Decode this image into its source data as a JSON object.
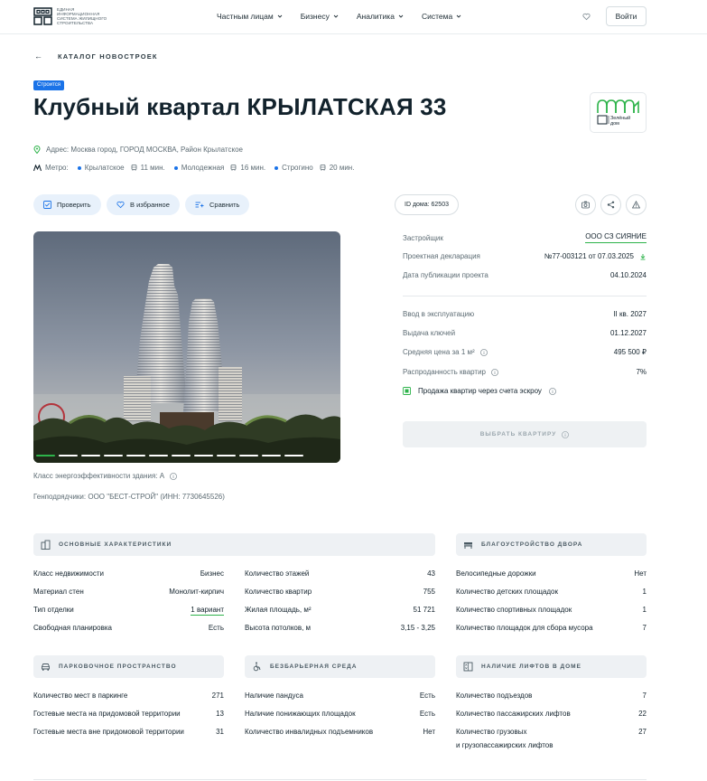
{
  "header": {
    "logo_text": "ЕДИНАЯ ИНФОРМАЦИОННАЯ СИСТЕМА ЖИЛИЩНОГО СТРОИТЕЛЬСТВА",
    "nav": [
      "Частным лицам",
      "Бизнесу",
      "Аналитика",
      "Система"
    ],
    "login": "Войти"
  },
  "breadcrumb": {
    "back": "←",
    "label": "КАТАЛОГ НОВОСТРОЕК"
  },
  "status": "Строится",
  "title": "Клубный квартал КРЫЛАТСКАЯ 33",
  "green_badge": {
    "line1": "Зелёный",
    "line2": "дом"
  },
  "address": "Адрес: Москва город, ГОРОД МОСКВА, Район Крылатское",
  "metro": {
    "label": "Метро:",
    "stations": [
      {
        "name": "Крылатское",
        "time": "11 мин."
      },
      {
        "name": "Молодежная",
        "time": "16 мин."
      },
      {
        "name": "Строгино",
        "time": "20 мин."
      }
    ]
  },
  "actions": {
    "check": "Проверить",
    "favorite": "В избранное",
    "compare": "Сравнить",
    "house_id": "ID дома: 62503"
  },
  "gallery": {
    "slide_count": 10,
    "active_slide": 1
  },
  "energy": "Класс энергоэффективности здания: А",
  "contractor": "Генподрядчики: ООО \"БЕСТ-СТРОЙ\" (ИНН: 7730645526)",
  "info": {
    "developer": {
      "k": "Застройщик",
      "v": "ООО СЗ СИЯНИЕ"
    },
    "declaration": {
      "k": "Проектная декларация",
      "v": "№77-003121 от 07.03.2025"
    },
    "published": {
      "k": "Дата публикации проекта",
      "v": "04.10.2024"
    },
    "commission": {
      "k": "Ввод в эксплуатацию",
      "v": "II кв. 2027"
    },
    "keys": {
      "k": "Выдача ключей",
      "v": "01.12.2027"
    },
    "price": {
      "k": "Средняя цена за 1 м²",
      "v": "495 500 ₽"
    },
    "sold": {
      "k": "Распроданность квартир",
      "v": "7%"
    },
    "escrow": "Продажа квартир через счета эскроу",
    "choose_btn": "ВЫБРАТЬ КВАРТИРУ"
  },
  "sections": {
    "main": {
      "title": "ОСНОВНЫЕ ХАРАКТЕРИСТИКИ",
      "left": [
        {
          "k": "Класс недвижимости",
          "v": "Бизнес"
        },
        {
          "k": "Материал стен",
          "v": "Монолит-кирпич"
        },
        {
          "k": "Тип отделки",
          "v": "1 вариант"
        },
        {
          "k": "Свободная планировка",
          "v": "Есть"
        }
      ],
      "right": [
        {
          "k": "Количество этажей",
          "v": "43"
        },
        {
          "k": "Количество квартир",
          "v": "755"
        },
        {
          "k": "Жилая площадь, м²",
          "v": "51 721"
        },
        {
          "k": "Высота потолков, м",
          "v": "3,15 - 3,25"
        }
      ]
    },
    "yard": {
      "title": "БЛАГОУСТРОЙСТВО ДВОРА",
      "rows": [
        {
          "k": "Велосипедные дорожки",
          "v": "Нет"
        },
        {
          "k": "Количество детских площадок",
          "v": "1"
        },
        {
          "k": "Количество спортивных площадок",
          "v": "1"
        },
        {
          "k": "Количество площадок для сбора мусора",
          "v": "7"
        }
      ]
    },
    "parking": {
      "title": "ПАРКОВОЧНОЕ ПРОСТРАНСТВО",
      "rows": [
        {
          "k": "Количество мест в паркинге",
          "v": "271"
        },
        {
          "k": "Гостевые места на придомовой территории",
          "v": "13"
        },
        {
          "k": "Гостевые места вне придомовой территории",
          "v": "31"
        }
      ]
    },
    "barrier": {
      "title": "БЕЗБАРЬЕРНАЯ СРЕДА",
      "rows": [
        {
          "k": "Наличие пандуса",
          "v": "Есть"
        },
        {
          "k": "Наличие понижающих площадок",
          "v": "Есть"
        },
        {
          "k": "Количество инвалидных подъемников",
          "v": "Нет"
        }
      ]
    },
    "lifts": {
      "title": "НАЛИЧИЕ ЛИФТОВ В ДОМЕ",
      "rows": [
        {
          "k": "Количество подъездов",
          "v": "7"
        },
        {
          "k": "Количество пассажирских лифтов",
          "v": "22"
        },
        {
          "k": "Количество грузовых",
          "k2": "и грузопассажирских лифтов",
          "v": "27"
        }
      ]
    }
  }
}
